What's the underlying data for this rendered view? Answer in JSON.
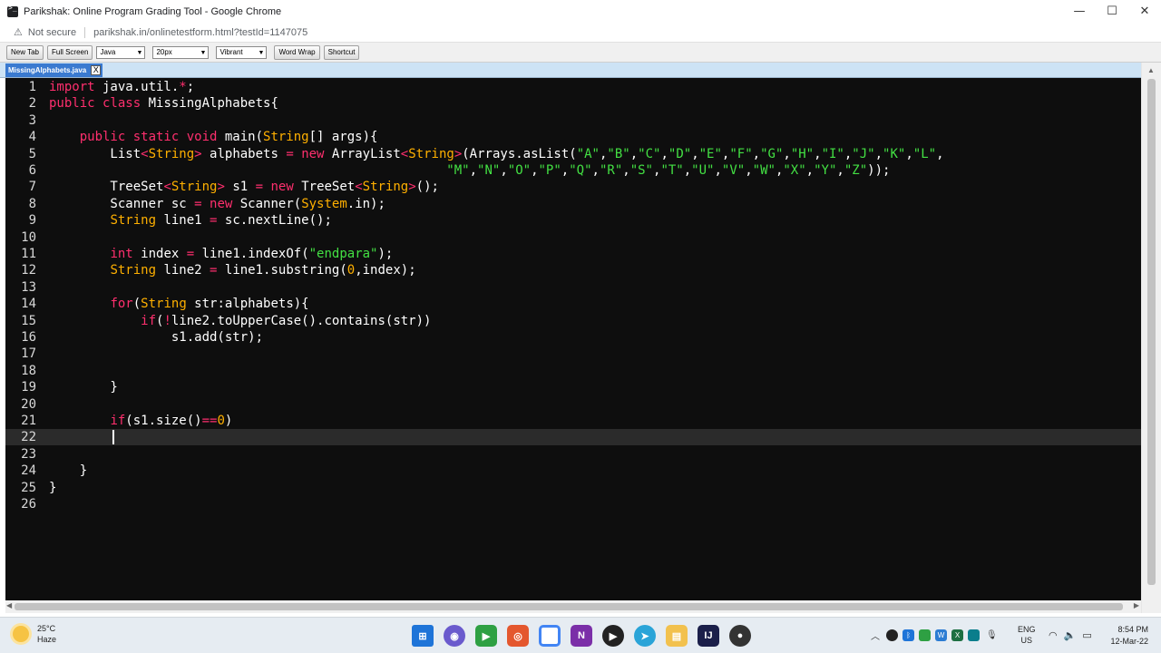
{
  "window": {
    "title": "Parikshak: Online Program Grading Tool - Google Chrome",
    "minimize_glyph": "—",
    "maximize_glyph": "☐",
    "close_glyph": "✕"
  },
  "address_bar": {
    "security_label": "Not secure",
    "warning_glyph": "⚠",
    "url": "parikshak.in/onlinetestform.html?testId=1147075"
  },
  "toolbar": {
    "new_tab_label": "New Tab",
    "full_screen_label": "Full Screen",
    "language_value": "Java",
    "font_size_value": "20px",
    "theme_value": "Vibrant",
    "word_wrap_label": "Word Wrap",
    "shortcut_label": "Shortcut"
  },
  "tab": {
    "file_name": "MissingAlphabets.java",
    "close_glyph": "X"
  },
  "editor": {
    "active_line": 22,
    "lines": [
      [
        [
          "k",
          "import"
        ],
        [
          "n",
          " java.util."
        ],
        [
          "o",
          "*"
        ],
        [
          "n",
          ";"
        ]
      ],
      [
        [
          "k",
          "public class"
        ],
        [
          "n",
          " MissingAlphabets{"
        ]
      ],
      [],
      [
        [
          "n",
          "    "
        ],
        [
          "k",
          "public static void"
        ],
        [
          "n",
          " main("
        ],
        [
          "t",
          "String"
        ],
        [
          "n",
          "[] args){"
        ]
      ],
      [
        [
          "n",
          "        List"
        ],
        [
          "o",
          "<"
        ],
        [
          "t",
          "String"
        ],
        [
          "o",
          ">"
        ],
        [
          "n",
          " alphabets "
        ],
        [
          "o",
          "="
        ],
        [
          "n",
          " "
        ],
        [
          "k",
          "new"
        ],
        [
          "n",
          " ArrayList"
        ],
        [
          "o",
          "<"
        ],
        [
          "t",
          "String"
        ],
        [
          "o",
          ">"
        ],
        [
          "n",
          "(Arrays.asList("
        ],
        [
          "s",
          "\"A\""
        ],
        [
          "n",
          ","
        ],
        [
          "s",
          "\"B\""
        ],
        [
          "n",
          ","
        ],
        [
          "s",
          "\"C\""
        ],
        [
          "n",
          ","
        ],
        [
          "s",
          "\"D\""
        ],
        [
          "n",
          ","
        ],
        [
          "s",
          "\"E\""
        ],
        [
          "n",
          ","
        ],
        [
          "s",
          "\"F\""
        ],
        [
          "n",
          ","
        ],
        [
          "s",
          "\"G\""
        ],
        [
          "n",
          ","
        ],
        [
          "s",
          "\"H\""
        ],
        [
          "n",
          ","
        ],
        [
          "s",
          "\"I\""
        ],
        [
          "n",
          ","
        ],
        [
          "s",
          "\"J\""
        ],
        [
          "n",
          ","
        ],
        [
          "s",
          "\"K\""
        ],
        [
          "n",
          ","
        ],
        [
          "s",
          "\"L\""
        ],
        [
          "n",
          ","
        ]
      ],
      [
        [
          "n",
          "                                                    "
        ],
        [
          "s",
          "\"M\""
        ],
        [
          "n",
          ","
        ],
        [
          "s",
          "\"N\""
        ],
        [
          "n",
          ","
        ],
        [
          "s",
          "\"O\""
        ],
        [
          "n",
          ","
        ],
        [
          "s",
          "\"P\""
        ],
        [
          "n",
          ","
        ],
        [
          "s",
          "\"Q\""
        ],
        [
          "n",
          ","
        ],
        [
          "s",
          "\"R\""
        ],
        [
          "n",
          ","
        ],
        [
          "s",
          "\"S\""
        ],
        [
          "n",
          ","
        ],
        [
          "s",
          "\"T\""
        ],
        [
          "n",
          ","
        ],
        [
          "s",
          "\"U\""
        ],
        [
          "n",
          ","
        ],
        [
          "s",
          "\"V\""
        ],
        [
          "n",
          ","
        ],
        [
          "s",
          "\"W\""
        ],
        [
          "n",
          ","
        ],
        [
          "s",
          "\"X\""
        ],
        [
          "n",
          ","
        ],
        [
          "s",
          "\"Y\""
        ],
        [
          "n",
          ","
        ],
        [
          "s",
          "\"Z\""
        ],
        [
          "n",
          "));"
        ]
      ],
      [
        [
          "n",
          "        TreeSet"
        ],
        [
          "o",
          "<"
        ],
        [
          "t",
          "String"
        ],
        [
          "o",
          ">"
        ],
        [
          "n",
          " s1 "
        ],
        [
          "o",
          "="
        ],
        [
          "n",
          " "
        ],
        [
          "k",
          "new"
        ],
        [
          "n",
          " TreeSet"
        ],
        [
          "o",
          "<"
        ],
        [
          "t",
          "String"
        ],
        [
          "o",
          ">"
        ],
        [
          "n",
          "();"
        ]
      ],
      [
        [
          "n",
          "        Scanner sc "
        ],
        [
          "o",
          "="
        ],
        [
          "n",
          " "
        ],
        [
          "k",
          "new"
        ],
        [
          "n",
          " Scanner("
        ],
        [
          "t",
          "System"
        ],
        [
          "n",
          ".in);"
        ]
      ],
      [
        [
          "n",
          "        "
        ],
        [
          "t",
          "String"
        ],
        [
          "n",
          " line1 "
        ],
        [
          "o",
          "="
        ],
        [
          "n",
          " sc.nextLine();"
        ]
      ],
      [],
      [
        [
          "n",
          "        "
        ],
        [
          "k",
          "int"
        ],
        [
          "n",
          " index "
        ],
        [
          "o",
          "="
        ],
        [
          "n",
          " line1.indexOf("
        ],
        [
          "s",
          "\"endpara\""
        ],
        [
          "n",
          ");"
        ]
      ],
      [
        [
          "n",
          "        "
        ],
        [
          "t",
          "String"
        ],
        [
          "n",
          " line2 "
        ],
        [
          "o",
          "="
        ],
        [
          "n",
          " line1.substring("
        ],
        [
          "t",
          "0"
        ],
        [
          "n",
          ",index);"
        ]
      ],
      [],
      [
        [
          "n",
          "        "
        ],
        [
          "k",
          "for"
        ],
        [
          "n",
          "("
        ],
        [
          "t",
          "String"
        ],
        [
          "n",
          " str:alphabets){"
        ]
      ],
      [
        [
          "n",
          "            "
        ],
        [
          "k",
          "if"
        ],
        [
          "n",
          "("
        ],
        [
          "o",
          "!"
        ],
        [
          "n",
          "line2.toUpperCase().contains(str))"
        ]
      ],
      [
        [
          "n",
          "                s1.add(str);"
        ]
      ],
      [],
      [],
      [
        [
          "n",
          "        }"
        ]
      ],
      [],
      [
        [
          "n",
          "        "
        ],
        [
          "k",
          "if"
        ],
        [
          "n",
          "(s1.size()"
        ],
        [
          "o",
          "=="
        ],
        [
          "t",
          "0"
        ],
        [
          "n",
          ")"
        ]
      ],
      [],
      [],
      [
        [
          "n",
          "    }"
        ]
      ],
      [
        [
          "n",
          "}"
        ]
      ],
      []
    ]
  },
  "taskbar": {
    "weather_temp": "25°C",
    "weather_desc": "Haze",
    "lang_line1": "ENG",
    "lang_line2": "US",
    "time": "8:54 PM",
    "date": "12-Mar-22"
  }
}
